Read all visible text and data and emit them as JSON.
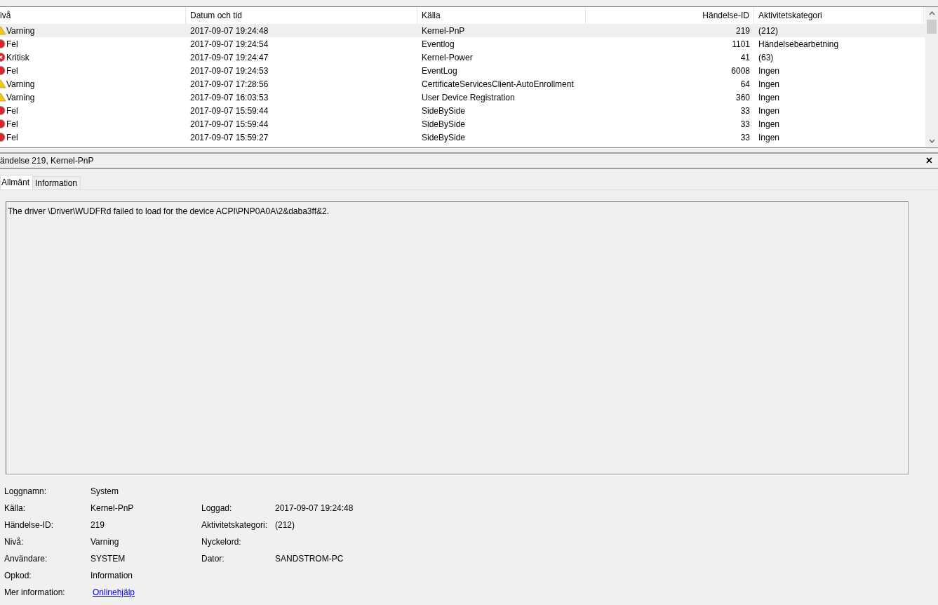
{
  "table": {
    "columns": [
      "ivå",
      "Datum och tid",
      "Källa",
      "Händelse-ID",
      "Aktivitetskategori"
    ],
    "rows": [
      {
        "kind": "warning",
        "level": "Varning",
        "date": "2017-09-07 19:24:48",
        "source": "Kernel-PnP",
        "id": "219",
        "category": "(212)",
        "selected": true
      },
      {
        "kind": "error",
        "level": "Fel",
        "date": "2017-09-07 19:24:54",
        "source": "Eventlog",
        "id": "1101",
        "category": "Händelsebearbetning",
        "selected": false
      },
      {
        "kind": "critical",
        "level": "Kritisk",
        "date": "2017-09-07 19:24:47",
        "source": "Kernel-Power",
        "id": "41",
        "category": "(63)",
        "selected": false
      },
      {
        "kind": "error",
        "level": "Fel",
        "date": "2017-09-07 19:24:53",
        "source": "EventLog",
        "id": "6008",
        "category": "Ingen",
        "selected": false
      },
      {
        "kind": "warning",
        "level": "Varning",
        "date": "2017-09-07 17:28:56",
        "source": "CertificateServicesClient-AutoEnrollment",
        "id": "64",
        "category": "Ingen",
        "selected": false
      },
      {
        "kind": "warning",
        "level": "Varning",
        "date": "2017-09-07 16:03:53",
        "source": "User Device Registration",
        "id": "360",
        "category": "Ingen",
        "selected": false
      },
      {
        "kind": "error",
        "level": "Fel",
        "date": "2017-09-07 15:59:44",
        "source": "SideBySide",
        "id": "33",
        "category": "Ingen",
        "selected": false
      },
      {
        "kind": "error",
        "level": "Fel",
        "date": "2017-09-07 15:59:44",
        "source": "SideBySide",
        "id": "33",
        "category": "Ingen",
        "selected": false
      },
      {
        "kind": "error",
        "level": "Fel",
        "date": "2017-09-07 15:59:27",
        "source": "SideBySide",
        "id": "33",
        "category": "Ingen",
        "selected": false
      }
    ]
  },
  "detail": {
    "title": "ändelse 219, Kernel-PnP",
    "close": "×",
    "tabs": [
      {
        "label": "Allmänt",
        "selected": true
      },
      {
        "label": "Information",
        "selected": false
      }
    ],
    "message": "The driver \\Driver\\WUDFRd failed to load for the device ACPI\\PNP0A0A\\2&daba3ff&2.",
    "fields_left": [
      {
        "label": "Loggnamn:",
        "value": "System",
        "kind": "text"
      },
      {
        "label": "Källa:",
        "value": "Kernel-PnP",
        "kind": "text"
      },
      {
        "label": "Händelse-ID:",
        "value": "219",
        "kind": "text"
      },
      {
        "label": "Nivå:",
        "value": "Varning",
        "kind": "text"
      },
      {
        "label": "Användare:",
        "value": "SYSTEM",
        "kind": "text"
      },
      {
        "label": "Opkod:",
        "value": "Information",
        "kind": "text"
      },
      {
        "label": "Mer information:",
        "value": "Onlinehjälp",
        "kind": "link"
      }
    ],
    "fields_right": [
      {
        "label": "Loggad:",
        "value": "2017-09-07 19:24:48"
      },
      {
        "label": "Aktivitetskategori:",
        "value": "(212)"
      },
      {
        "label": "Nyckelord:"
      },
      {
        "label": "Dator:",
        "value": "SANDSTROM-PC"
      }
    ]
  }
}
